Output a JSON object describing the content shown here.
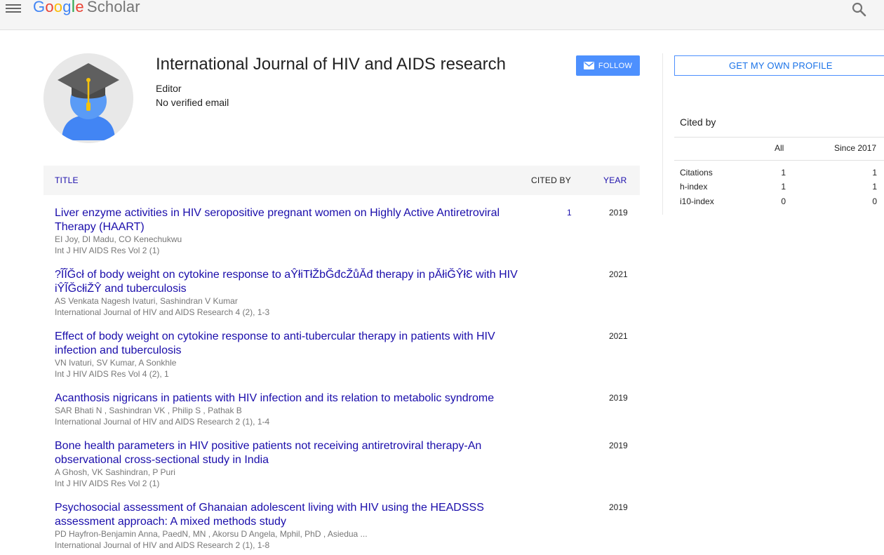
{
  "header": {
    "logo_g": "G",
    "logo_o1": "o",
    "logo_o2": "o",
    "logo_g2": "g",
    "logo_l": "l",
    "logo_e": "e",
    "logo_scholar": "Scholar",
    "colors": {
      "blue": "#4285f4",
      "red": "#ea4335",
      "yellow": "#fbbc05",
      "green": "#34a853"
    }
  },
  "profile": {
    "name": "International Journal of HIV and AIDS research",
    "affiliation": "Editor",
    "email": "No verified email",
    "follow_label": "FOLLOW"
  },
  "table": {
    "col_title": "TITLE",
    "col_cited": "CITED BY",
    "col_year": "YEAR",
    "rows": [
      {
        "title": "Liver enzyme activities in HIV seropositive pregnant women on Highly Active Antiretroviral Therapy (HAART)",
        "authors": "EI Joy, DI Madu, CO Kenechukwu",
        "venue": "Int J HIV AIDS Res Vol 2 (1)",
        "cited": "1",
        "year": "2019"
      },
      {
        "title": "?ĨĨĞcł of body weight on cytokine response to aŶłiΤłŽbĞđcŽůĂđ therapy in pĂłiĞŶłƐ with HIV iŶĨĞcłiŽŶ and tuberculosis",
        "authors": "AS Venkata Nagesh Ivaturi, Sashindran V Kumar",
        "venue": "International Journal of HIV and AIDS Research 4 (2), 1-3",
        "cited": "",
        "year": "2021"
      },
      {
        "title": "Effect of body weight on cytokine response to anti-tubercular therapy in patients with HIV infection and tuberculosis",
        "authors": "VN Ivaturi, SV Kumar, A Sonkhle",
        "venue": "Int J HIV AIDS Res Vol 4 (2), 1",
        "cited": "",
        "year": "2021"
      },
      {
        "title": "Acanthosis nigricans in patients with HIV infection and its relation to metabolic syndrome",
        "authors": "SAR Bhati N , Sashindran VK , Philip S , Pathak B",
        "venue": "International Journal of HIV and AIDS Research 2 (1), 1-4",
        "cited": "",
        "year": "2019"
      },
      {
        "title": "Bone health parameters in HIV positive patients not receiving antiretroviral therapy-An observational cross-sectional study in India",
        "authors": "A Ghosh, VK Sashindran, P Puri",
        "venue": "Int J HIV AIDS Res Vol 2 (1)",
        "cited": "",
        "year": "2019"
      },
      {
        "title": "Psychosocial assessment of Ghanaian adolescent living with HIV using the HEADSSS assessment approach: A mixed methods study",
        "authors": "PD Hayfron-Benjamin Anna, PaedN, MN , Akorsu D Angela, Mphil, PhD , Asiedua ...",
        "venue": "International Journal of HIV and AIDS Research 2 (1), 1-8",
        "cited": "",
        "year": "2019"
      }
    ]
  },
  "sidebar": {
    "own_profile_label": "GET MY OWN PROFILE",
    "cited_by_heading": "Cited by",
    "col_all": "All",
    "col_since": "Since 2017",
    "stats": [
      {
        "label": "Citations",
        "all": "1",
        "since": "1"
      },
      {
        "label": "h-index",
        "all": "1",
        "since": "1"
      },
      {
        "label": "i10-index",
        "all": "0",
        "since": "0"
      }
    ]
  }
}
